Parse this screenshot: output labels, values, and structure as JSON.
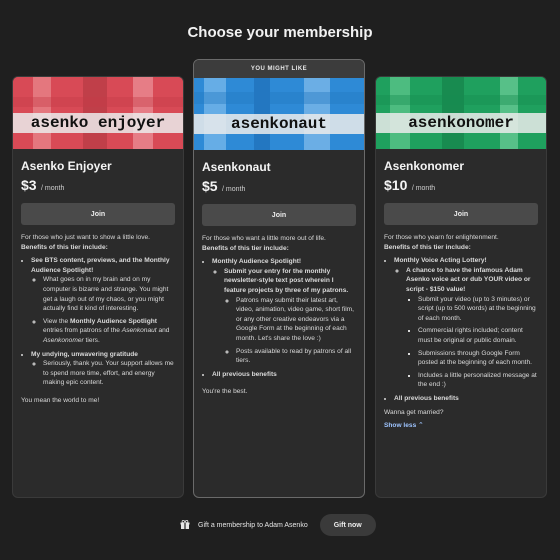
{
  "page": {
    "title": "Choose your membership"
  },
  "tiers": [
    {
      "banner_text": "asenko enjoyer",
      "banner_color": "#d84a56",
      "name": "Asenko Enjoyer",
      "price": "$3",
      "period": "/ month",
      "join_label": "Join",
      "intro": "For those who just want to show a little love.",
      "benefits_header": "Benefits of this tier include:",
      "b1_title": "See BTS content, previews, and the Monthly Audience Spotlight!",
      "b1_sub1": "What goes on in my brain and on my computer is bizarre and strange. You might get a laugh out of my chaos, or you might actually find it kind of interesting.",
      "b1_sub2_a": "View the ",
      "b1_sub2_b": "Monthly Audience Spotlight",
      "b1_sub2_c": " entries from patrons of the ",
      "b1_sub2_d": "Asenkonaut",
      "b1_sub2_e": " and ",
      "b1_sub2_f": "Asenkonomer",
      "b1_sub2_g": " tiers.",
      "b2_title": "My undying, unwavering gratitude",
      "b2_sub1": "Seriously, thank you. Your support allows me to spend more time, effort, and energy making epic content.",
      "closing": "You mean the world to me!"
    },
    {
      "ribbon": "YOU MIGHT LIKE",
      "banner_text": "asenkonaut",
      "banner_color": "#2e8ad6",
      "name": "Asenkonaut",
      "price": "$5",
      "period": "/ month",
      "join_label": "Join",
      "intro": "For those who want a little more out of life.",
      "benefits_header": "Benefits of this tier include:",
      "b1_title": "Monthly Audience Spotlight!",
      "b1_sub1": "Submit your entry for the monthly newsletter-style text post wherein I feature projects by three of my patrons.",
      "b1_sub1a": "Patrons may submit their latest art, video, animation, video game, short film, or any other creative endeavors via a Google Form at the beginning of each month. Let's share the love :)",
      "b1_sub1b": "Posts available to read by patrons of all tiers.",
      "b2_title": "All previous benefits",
      "closing": "You're the best."
    },
    {
      "banner_text": "asenkonomer",
      "banner_color": "#1fa05e",
      "name": "Asenkonomer",
      "price": "$10",
      "period": "/ month",
      "join_label": "Join",
      "intro": "For those who yearn for enlightenment.",
      "benefits_header": "Benefits of this tier include:",
      "b1_title": "Monthly Voice Acting Lottery!",
      "b1_sub1": "A chance to have the infamous Adam Asenko voice act or dub YOUR video or script - $150 value!",
      "b1_sub1a": "Submit your video (up to 3 minutes) or script (up to 500 words) at the beginning of each month.",
      "b1_sub1b": "Commercial rights included; content must be original or public domain.",
      "b1_sub1c": "Submissions through Google Form posted at the beginning of each month.",
      "b1_sub1d": "Includes a little personalized message at the end :)",
      "b2_title": "All previous benefits",
      "closing": "Wanna get married?",
      "show_less": "Show less"
    }
  ],
  "footer": {
    "gift_text": "Gift a membership to Adam Asenko",
    "gift_button": "Gift now"
  },
  "icons": {
    "gift": "gift-icon",
    "chevron_up": "chevron-up-icon"
  }
}
